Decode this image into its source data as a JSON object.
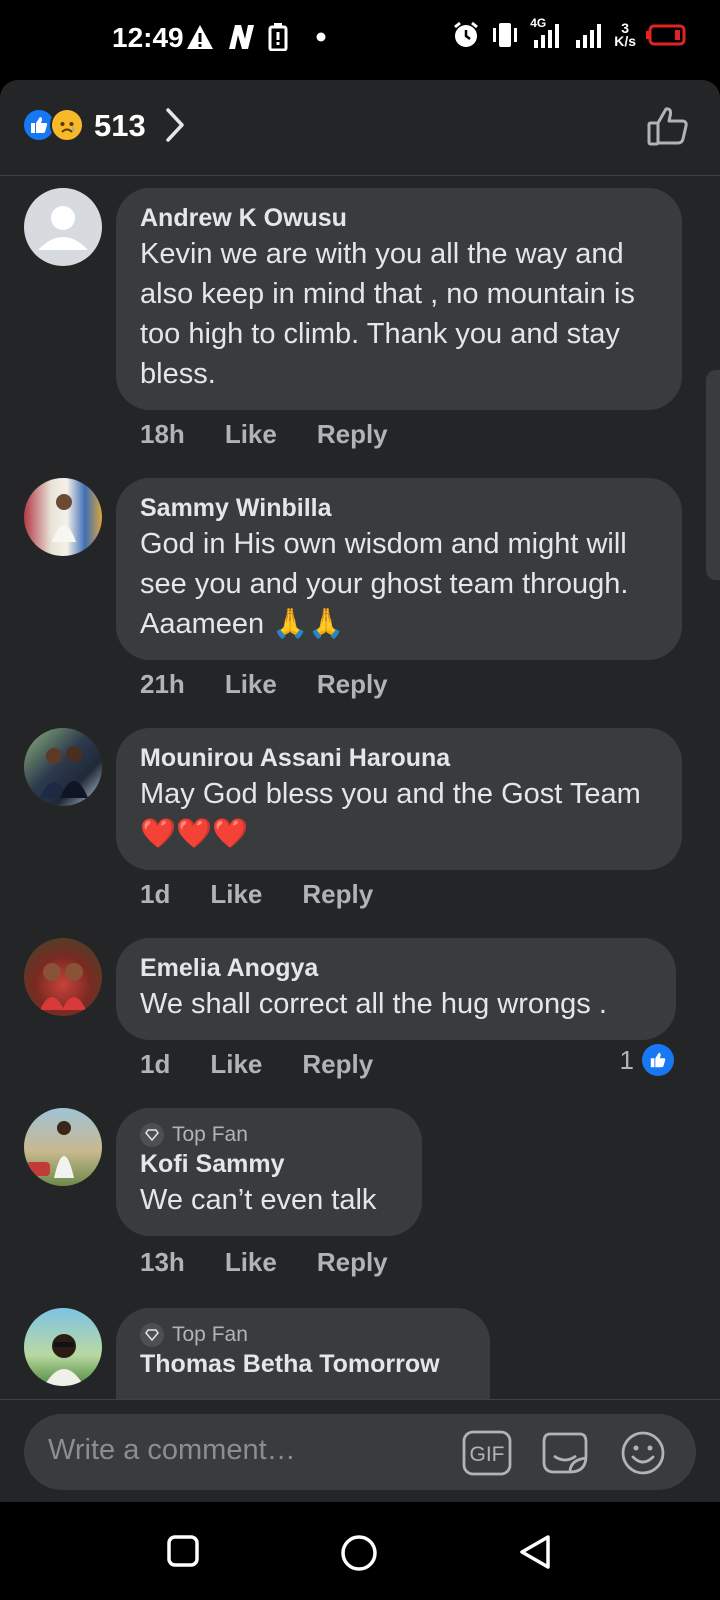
{
  "status_bar": {
    "time": "12:49",
    "network": "4G",
    "speed_value": "3",
    "speed_unit": "K/s"
  },
  "reactions": {
    "count": "513"
  },
  "comments": [
    {
      "author": "Andrew K Owusu",
      "text": "Kevin we are with you all the way and also keep in mind that , no mountain is too high to climb. Thank you and stay bless.",
      "time": "18h",
      "like_label": "Like",
      "reply_label": "Reply"
    },
    {
      "author": "Sammy Winbilla",
      "text": "God in His own wisdom and might will see you and your ghost team through. Aaameen 🙏🙏",
      "time": "21h",
      "like_label": "Like",
      "reply_label": "Reply"
    },
    {
      "author": "Mounirou Assani Harouna",
      "text": "May God bless you and the Gost Team ❤️❤️❤️",
      "time": "1d",
      "like_label": "Like",
      "reply_label": "Reply"
    },
    {
      "author": "Emelia Anogya",
      "text": "We shall correct all the hug wrongs .",
      "time": "1d",
      "like_label": "Like",
      "reply_label": "Reply",
      "likes": "1"
    },
    {
      "badge": "Top Fan",
      "author": "Kofi Sammy",
      "text": "We can’t even talk",
      "time": "13h",
      "like_label": "Like",
      "reply_label": "Reply"
    },
    {
      "badge": "Top Fan",
      "author": "Thomas Betha Tomorrow"
    }
  ],
  "composer": {
    "placeholder": "Write a comment…",
    "gif_label": "GIF"
  },
  "colors": {
    "background": "#242526",
    "bubble": "#3a3b3c",
    "accent": "#1877f2",
    "text": "#e4e6eb",
    "muted": "#b0b3b8"
  },
  "icons": [
    "warning-icon",
    "n-app-icon",
    "battery-saver-icon",
    "alarm-icon",
    "vibrate-icon",
    "signal-icon",
    "battery-icon",
    "like-reaction-icon",
    "sad-reaction-icon",
    "chevron-right-icon",
    "thumbs-up-icon",
    "gif-icon",
    "sticker-icon",
    "emoji-icon",
    "nav-recents-icon",
    "nav-home-icon",
    "nav-back-icon"
  ]
}
